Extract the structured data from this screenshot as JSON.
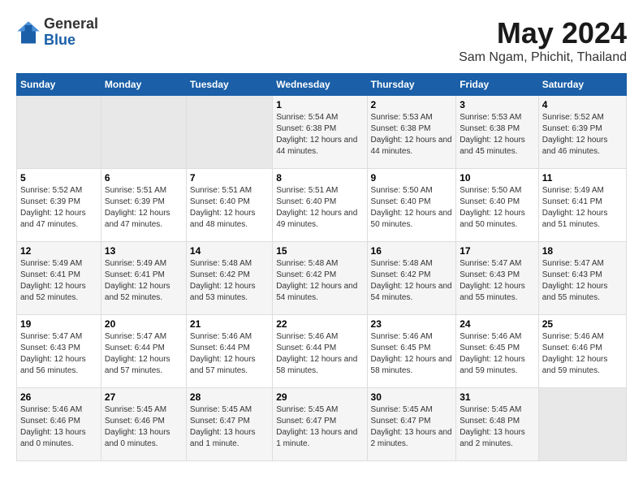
{
  "header": {
    "logo_general": "General",
    "logo_blue": "Blue",
    "title": "May 2024",
    "subtitle": "Sam Ngam, Phichit, Thailand"
  },
  "calendar": {
    "days_of_week": [
      "Sunday",
      "Monday",
      "Tuesday",
      "Wednesday",
      "Thursday",
      "Friday",
      "Saturday"
    ],
    "weeks": [
      [
        {
          "day": "",
          "empty": true
        },
        {
          "day": "",
          "empty": true
        },
        {
          "day": "",
          "empty": true
        },
        {
          "day": "1",
          "sunrise": "5:54 AM",
          "sunset": "6:38 PM",
          "daylight": "12 hours and 44 minutes."
        },
        {
          "day": "2",
          "sunrise": "5:53 AM",
          "sunset": "6:38 PM",
          "daylight": "12 hours and 44 minutes."
        },
        {
          "day": "3",
          "sunrise": "5:53 AM",
          "sunset": "6:38 PM",
          "daylight": "12 hours and 45 minutes."
        },
        {
          "day": "4",
          "sunrise": "5:52 AM",
          "sunset": "6:39 PM",
          "daylight": "12 hours and 46 minutes."
        }
      ],
      [
        {
          "day": "5",
          "sunrise": "5:52 AM",
          "sunset": "6:39 PM",
          "daylight": "12 hours and 47 minutes."
        },
        {
          "day": "6",
          "sunrise": "5:51 AM",
          "sunset": "6:39 PM",
          "daylight": "12 hours and 47 minutes."
        },
        {
          "day": "7",
          "sunrise": "5:51 AM",
          "sunset": "6:40 PM",
          "daylight": "12 hours and 48 minutes."
        },
        {
          "day": "8",
          "sunrise": "5:51 AM",
          "sunset": "6:40 PM",
          "daylight": "12 hours and 49 minutes."
        },
        {
          "day": "9",
          "sunrise": "5:50 AM",
          "sunset": "6:40 PM",
          "daylight": "12 hours and 50 minutes."
        },
        {
          "day": "10",
          "sunrise": "5:50 AM",
          "sunset": "6:40 PM",
          "daylight": "12 hours and 50 minutes."
        },
        {
          "day": "11",
          "sunrise": "5:49 AM",
          "sunset": "6:41 PM",
          "daylight": "12 hours and 51 minutes."
        }
      ],
      [
        {
          "day": "12",
          "sunrise": "5:49 AM",
          "sunset": "6:41 PM",
          "daylight": "12 hours and 52 minutes."
        },
        {
          "day": "13",
          "sunrise": "5:49 AM",
          "sunset": "6:41 PM",
          "daylight": "12 hours and 52 minutes."
        },
        {
          "day": "14",
          "sunrise": "5:48 AM",
          "sunset": "6:42 PM",
          "daylight": "12 hours and 53 minutes."
        },
        {
          "day": "15",
          "sunrise": "5:48 AM",
          "sunset": "6:42 PM",
          "daylight": "12 hours and 54 minutes."
        },
        {
          "day": "16",
          "sunrise": "5:48 AM",
          "sunset": "6:42 PM",
          "daylight": "12 hours and 54 minutes."
        },
        {
          "day": "17",
          "sunrise": "5:47 AM",
          "sunset": "6:43 PM",
          "daylight": "12 hours and 55 minutes."
        },
        {
          "day": "18",
          "sunrise": "5:47 AM",
          "sunset": "6:43 PM",
          "daylight": "12 hours and 55 minutes."
        }
      ],
      [
        {
          "day": "19",
          "sunrise": "5:47 AM",
          "sunset": "6:43 PM",
          "daylight": "12 hours and 56 minutes."
        },
        {
          "day": "20",
          "sunrise": "5:47 AM",
          "sunset": "6:44 PM",
          "daylight": "12 hours and 57 minutes."
        },
        {
          "day": "21",
          "sunrise": "5:46 AM",
          "sunset": "6:44 PM",
          "daylight": "12 hours and 57 minutes."
        },
        {
          "day": "22",
          "sunrise": "5:46 AM",
          "sunset": "6:44 PM",
          "daylight": "12 hours and 58 minutes."
        },
        {
          "day": "23",
          "sunrise": "5:46 AM",
          "sunset": "6:45 PM",
          "daylight": "12 hours and 58 minutes."
        },
        {
          "day": "24",
          "sunrise": "5:46 AM",
          "sunset": "6:45 PM",
          "daylight": "12 hours and 59 minutes."
        },
        {
          "day": "25",
          "sunrise": "5:46 AM",
          "sunset": "6:46 PM",
          "daylight": "12 hours and 59 minutes."
        }
      ],
      [
        {
          "day": "26",
          "sunrise": "5:46 AM",
          "sunset": "6:46 PM",
          "daylight": "13 hours and 0 minutes."
        },
        {
          "day": "27",
          "sunrise": "5:45 AM",
          "sunset": "6:46 PM",
          "daylight": "13 hours and 0 minutes."
        },
        {
          "day": "28",
          "sunrise": "5:45 AM",
          "sunset": "6:47 PM",
          "daylight": "13 hours and 1 minute."
        },
        {
          "day": "29",
          "sunrise": "5:45 AM",
          "sunset": "6:47 PM",
          "daylight": "13 hours and 1 minute."
        },
        {
          "day": "30",
          "sunrise": "5:45 AM",
          "sunset": "6:47 PM",
          "daylight": "13 hours and 2 minutes."
        },
        {
          "day": "31",
          "sunrise": "5:45 AM",
          "sunset": "6:48 PM",
          "daylight": "13 hours and 2 minutes."
        },
        {
          "day": "",
          "empty": true
        }
      ]
    ],
    "labels": {
      "sunrise": "Sunrise:",
      "sunset": "Sunset:",
      "daylight": "Daylight:"
    }
  }
}
